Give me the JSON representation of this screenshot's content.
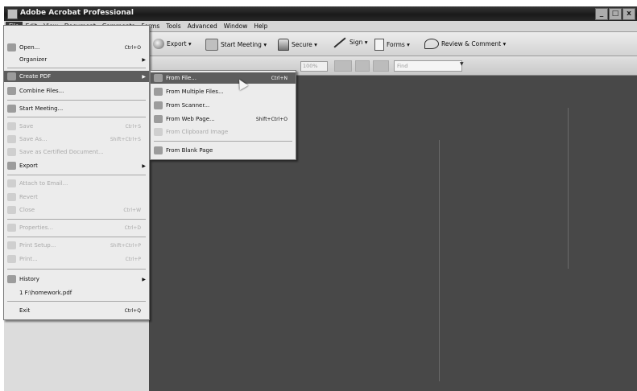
{
  "window": {
    "title": "Adobe Acrobat Professional",
    "controls": [
      "_",
      "□",
      "x"
    ]
  },
  "menubar": {
    "items": [
      "File",
      "Edit",
      "View",
      "Document",
      "Comments",
      "Forms",
      "Tools",
      "Advanced",
      "Window",
      "Help"
    ]
  },
  "toolbar": {
    "export": "Export ▾",
    "start_meeting": "Start Meeting ▾",
    "secure": "Secure ▾",
    "sign": "Sign ▾",
    "forms": "Forms ▾",
    "review": "Review & Comment ▾",
    "zoom": "100%",
    "find": "Find"
  },
  "file_menu": {
    "open": {
      "label": "Open...",
      "shortcut": "Ctrl+O"
    },
    "organizer": {
      "label": "Organizer"
    },
    "create_pdf": {
      "label": "Create PDF"
    },
    "combine": {
      "label": "Combine Files..."
    },
    "start_meeting": {
      "label": "Start Meeting..."
    },
    "save": {
      "label": "Save",
      "shortcut": "Ctrl+S"
    },
    "save_as": {
      "label": "Save As...",
      "shortcut": "Shift+Ctrl+S"
    },
    "save_certified": {
      "label": "Save as Certified Document..."
    },
    "export": {
      "label": "Export"
    },
    "attach": {
      "label": "Attach to Email..."
    },
    "revert": {
      "label": "Revert"
    },
    "close": {
      "label": "Close",
      "shortcut": "Ctrl+W"
    },
    "properties": {
      "label": "Properties...",
      "shortcut": "Ctrl+D"
    },
    "print_setup": {
      "label": "Print Setup...",
      "shortcut": "Shift+Ctrl+P"
    },
    "print": {
      "label": "Print...",
      "shortcut": "Ctrl+P"
    },
    "history": {
      "label": "History"
    },
    "recent": {
      "label": "1 F:\\homework.pdf"
    },
    "exit": {
      "label": "Exit",
      "shortcut": "Ctrl+Q"
    }
  },
  "create_submenu": {
    "from_file": {
      "label": "From File...",
      "shortcut": "Ctrl+N"
    },
    "from_multiple": {
      "label": "From Multiple Files..."
    },
    "from_scanner": {
      "label": "From Scanner..."
    },
    "from_web": {
      "label": "From Web Page...",
      "shortcut": "Shift+Ctrl+O"
    },
    "from_clipboard": {
      "label": "From Clipboard Image"
    },
    "from_blank": {
      "label": "From Blank Page"
    }
  }
}
